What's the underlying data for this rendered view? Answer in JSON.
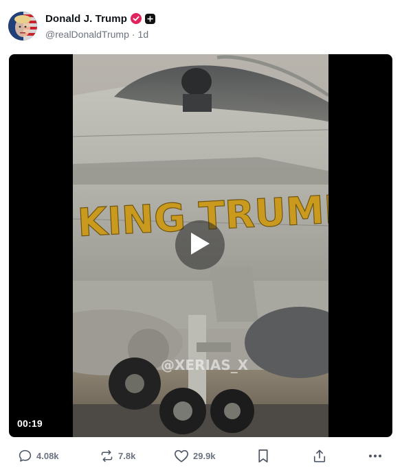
{
  "post": {
    "author": {
      "display_name": "Donald J. Trump",
      "handle": "@realDonaldTrump",
      "time_ago": "1d",
      "separator": "·"
    },
    "media": {
      "type": "video",
      "duration": "00:19",
      "overlay_text": "KING TRUMP",
      "watermark": "@XERIAS_X"
    },
    "actions": {
      "replies": "4.08k",
      "reposts": "7.8k",
      "likes": "29.9k"
    }
  },
  "colors": {
    "verified": "#e0245e",
    "muted_text": "#6b7280",
    "jet_lettering": "#c99a1e"
  },
  "icons": [
    "verified-icon",
    "plus-icon",
    "play-icon",
    "reply-icon",
    "repost-icon",
    "like-icon",
    "bookmark-icon",
    "share-icon",
    "more-icon"
  ]
}
